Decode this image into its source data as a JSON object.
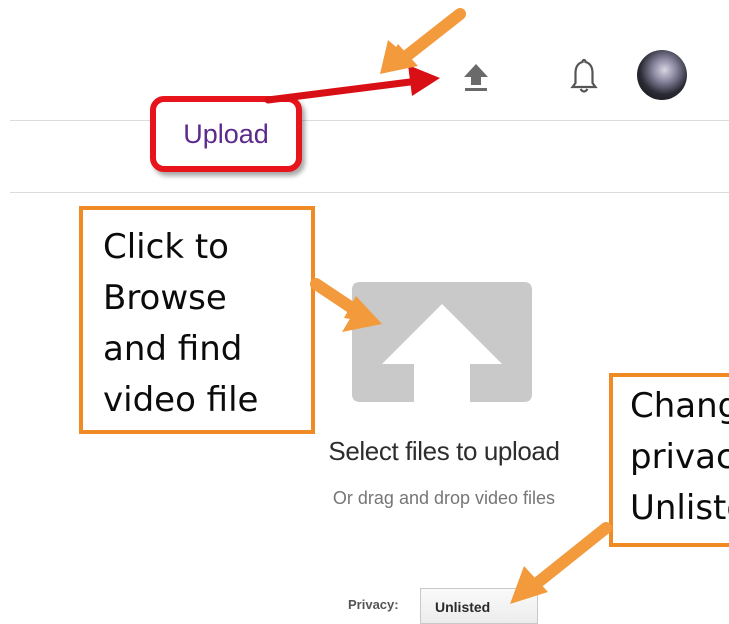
{
  "header": {
    "icons": [
      "upload-icon",
      "bell-icon",
      "avatar"
    ]
  },
  "callouts": {
    "upload": "Upload",
    "browse_lines": [
      "Click to",
      "Browse",
      "and find",
      "video file"
    ],
    "privacy_lines": [
      "Chang",
      "privac",
      "Unliste"
    ]
  },
  "upload_area": {
    "title": "Select files to upload",
    "subtitle": "Or drag and drop video files"
  },
  "privacy": {
    "label": "Privacy:",
    "selected": "Unlisted"
  },
  "colors": {
    "callout_orange": "#f08a24",
    "callout_red": "#e8141c",
    "upload_text": "#5b2a8c",
    "graphic_gray": "#c9c9c9"
  }
}
